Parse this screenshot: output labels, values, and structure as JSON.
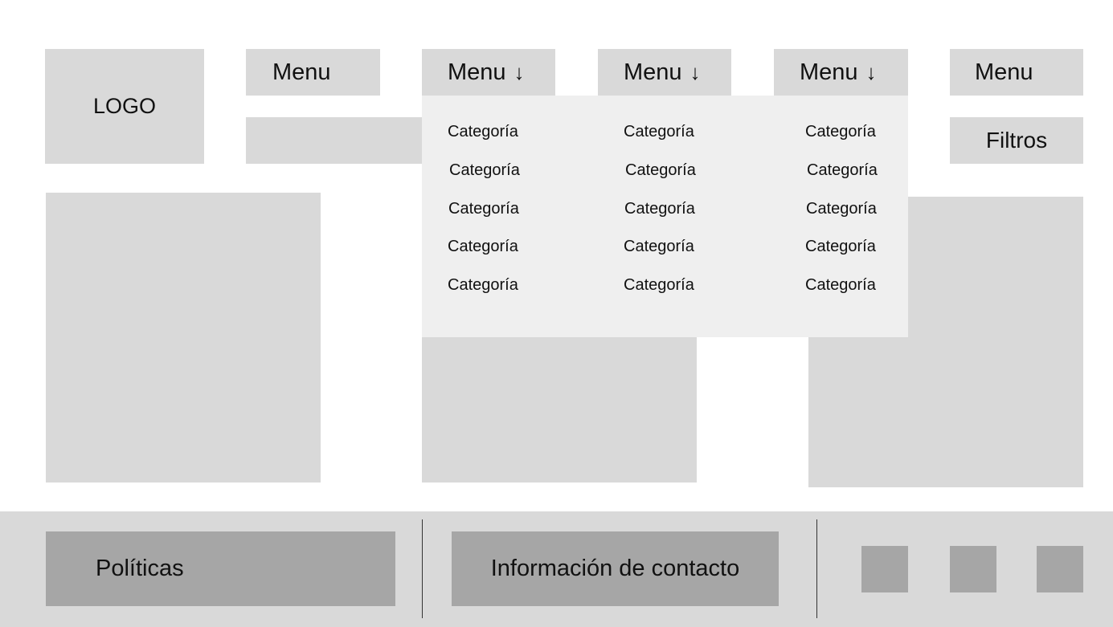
{
  "header": {
    "logo_text": "LOGO",
    "menus": [
      {
        "label": "Menu",
        "has_dropdown": false
      },
      {
        "label": "Menu",
        "has_dropdown": true
      },
      {
        "label": "Menu",
        "has_dropdown": true
      },
      {
        "label": "Menu",
        "has_dropdown": true
      },
      {
        "label": "Menu",
        "has_dropdown": false
      }
    ],
    "arrow_icon": "↓",
    "filters_label": "Filtros"
  },
  "dropdown": {
    "columns": [
      [
        "Categoría",
        "Categoría",
        "Categoría",
        "Categoría",
        "Categoría"
      ],
      [
        "Categoría",
        "Categoría",
        "Categoría",
        "Categoría",
        "Categoría"
      ],
      [
        "Categoría",
        "Categoría",
        "Categoría",
        "Categoría",
        "Categoría"
      ]
    ]
  },
  "footer": {
    "policies_label": "Políticas",
    "contact_label": "Información de contacto",
    "social_icons": [
      "social-icon-1",
      "social-icon-2",
      "social-icon-3"
    ]
  },
  "colors": {
    "placeholder": "#d9d9d9",
    "dropdown_bg": "#efefef",
    "footer_block": "#a6a6a6"
  }
}
